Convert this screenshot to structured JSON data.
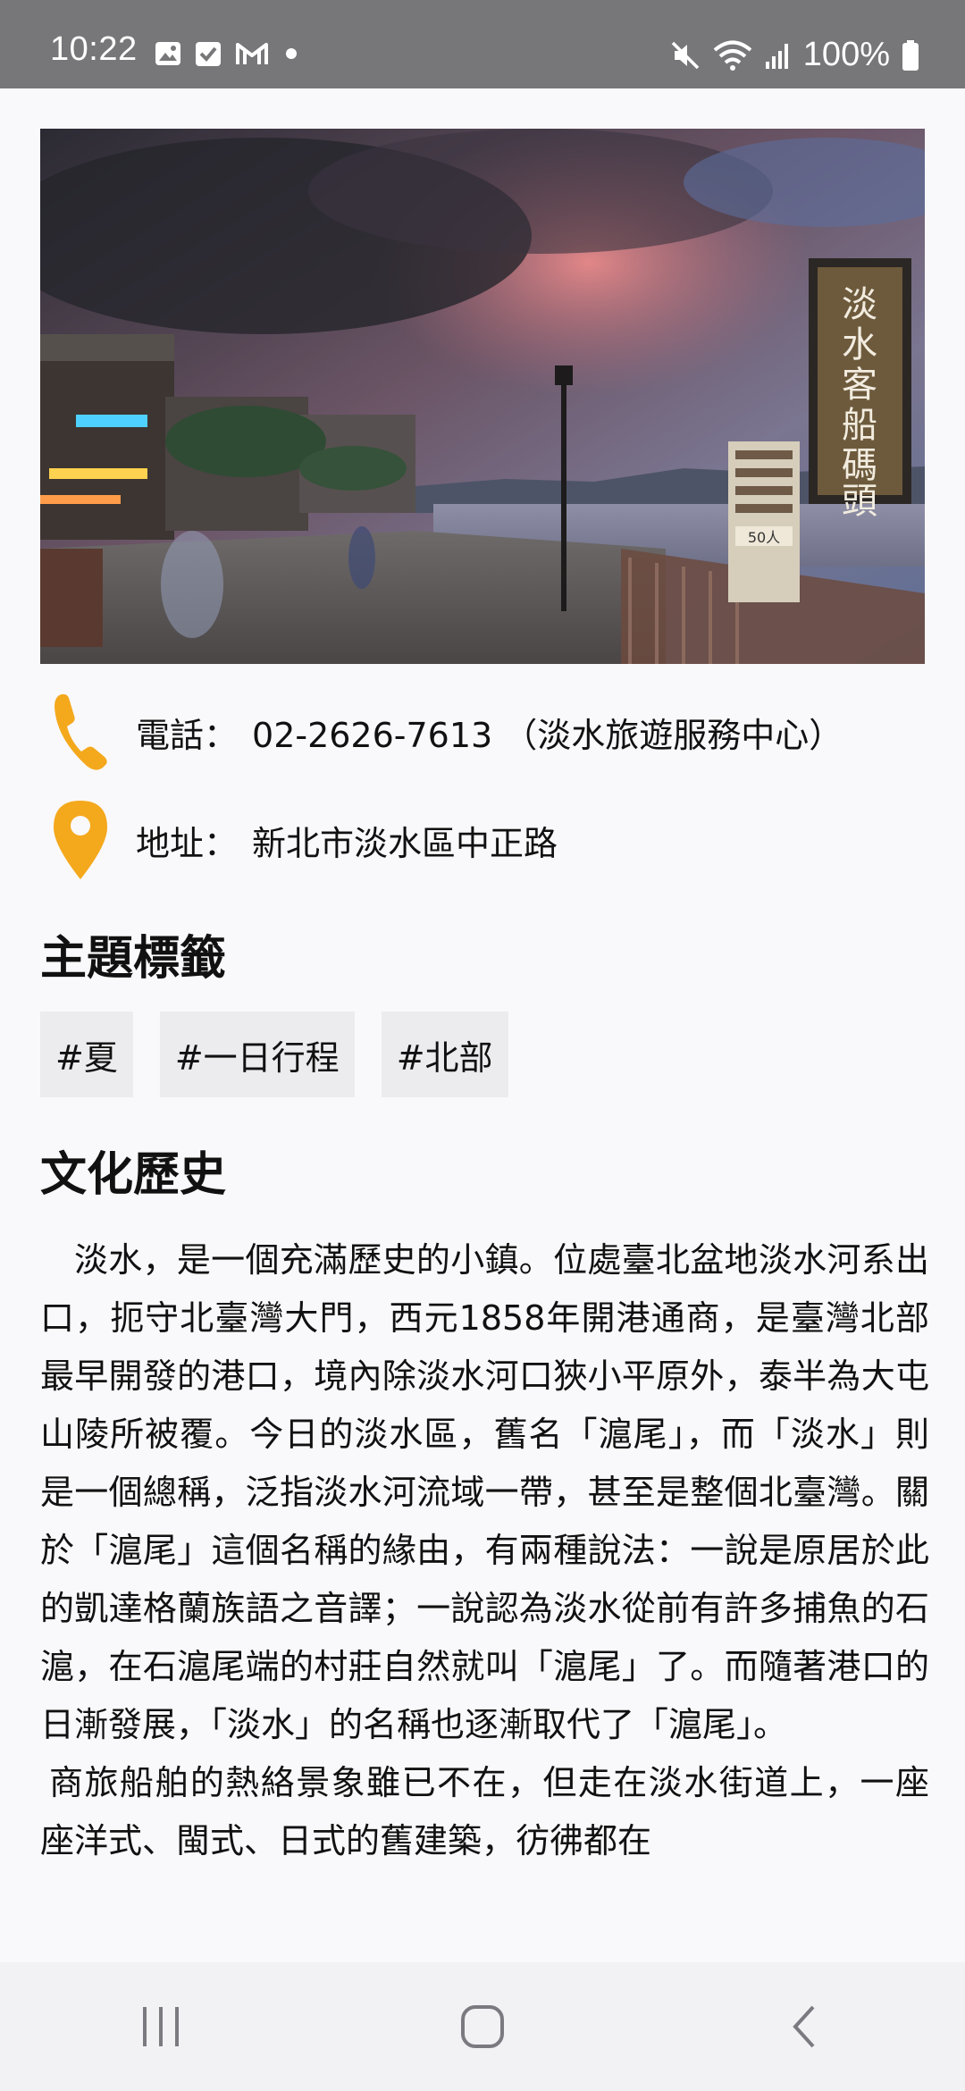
{
  "status_bar": {
    "time": "10:22",
    "battery": "100%",
    "icons_left": [
      "gallery-icon",
      "check-icon",
      "gmail-icon",
      "dot-icon"
    ],
    "icons_right": [
      "mute-icon",
      "wifi-icon",
      "signal-icon",
      "battery-icon"
    ]
  },
  "hero": {
    "sign_text": "淡水客船碼頭",
    "board_text": "50人"
  },
  "contact": {
    "phone_label": "電話：",
    "phone_value": "02-2626-7613 （淡水旅遊服務中心）",
    "address_label": "地址：",
    "address_value": "新北市淡水區中正路"
  },
  "tags_section": {
    "title": "主題標籤",
    "tags": [
      "#夏",
      "#一日行程",
      "#北部"
    ]
  },
  "history_section": {
    "title": "文化歷史",
    "paragraphs": [
      "淡水，是一個充滿歷史的小鎮。位處臺北盆地淡水河系出口，扼守北臺灣大門，西元1858年開港通商，是臺灣北部最早開發的港口，境內除淡水河口狹小平原外，泰半為大屯山陵所被覆。今日的淡水區，舊名「滬尾」，而「淡水」則是一個總稱，泛指淡水河流域一帶，甚至是整個北臺灣。關於「滬尾」這個名稱的緣由，有兩種說法：一說是原居於此的凱達格蘭族語之音譯；一說認為淡水從前有許多捕魚的石滬，在石滬尾端的村莊自然就叫「滬尾」了。而隨著港口的日漸發展，「淡水」的名稱也逐漸取代了「滬尾」。",
      "商旅船舶的熱絡景象雖已不在，但走在淡水街道上，一座座洋式、閩式、日式的舊建築，彷彿都在"
    ]
  },
  "colors": {
    "accent": "#f4a81c",
    "status_bar": "#777779",
    "tag_bg": "#ececee"
  }
}
